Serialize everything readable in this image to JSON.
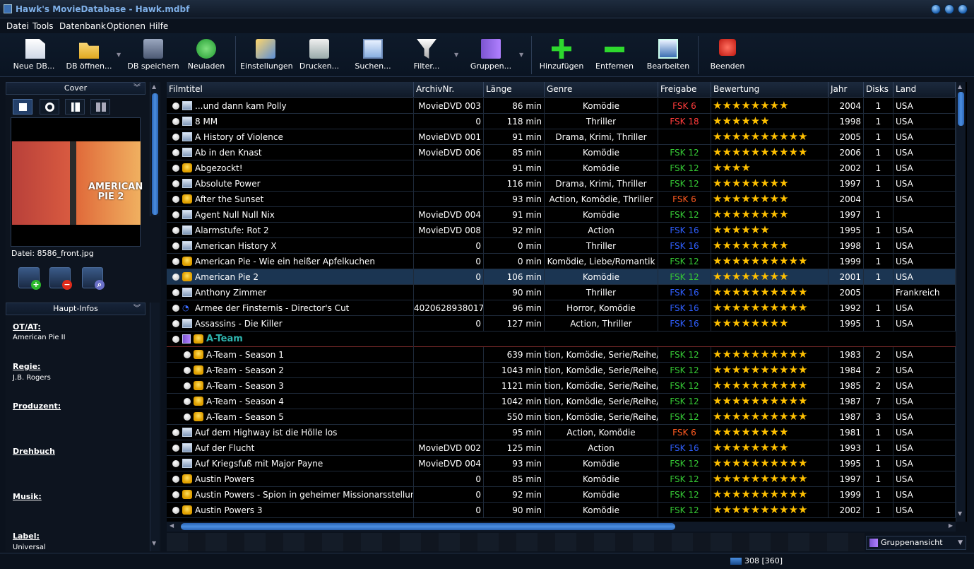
{
  "window": {
    "title": "Hawk's MovieDatabase - Hawk.mdbf"
  },
  "menu": [
    "Datei",
    "Tools",
    "Datenbank",
    "Optionen",
    "Hilfe"
  ],
  "toolbar": [
    {
      "label": "Neue DB...",
      "icon": "new-document-icon"
    },
    {
      "label": "DB öffnen...",
      "icon": "open-folder-icon"
    },
    {
      "label": "DB speichern",
      "icon": "save-icon"
    },
    {
      "label": "Neuladen",
      "icon": "reload-icon"
    },
    {
      "label": "Einstellungen",
      "icon": "settings-icon"
    },
    {
      "label": "Drucken...",
      "icon": "print-icon"
    },
    {
      "label": "Suchen...",
      "icon": "search-icon"
    },
    {
      "label": "Filter...",
      "icon": "filter-icon"
    },
    {
      "label": "Gruppen...",
      "icon": "groups-icon"
    },
    {
      "label": "Hinzufügen",
      "icon": "add-icon"
    },
    {
      "label": "Entfernen",
      "icon": "remove-icon"
    },
    {
      "label": "Bearbeiten",
      "icon": "edit-icon"
    },
    {
      "label": "Beenden",
      "icon": "power-icon"
    }
  ],
  "left": {
    "cover_header": "Cover",
    "cover_text": "AMERICAN PIE 2",
    "file_label": "Datei: 8586_front.jpg",
    "info_header": "Haupt-Infos",
    "info": [
      {
        "label": "OT/AT:",
        "value": "American Pie II"
      },
      {
        "label": "Regie:",
        "value": "J.B. Rogers"
      },
      {
        "label": "Produzent:",
        "value": ""
      },
      {
        "label": "Drehbuch",
        "value": ""
      },
      {
        "label": "Musik:",
        "value": ""
      },
      {
        "label": "Label:",
        "value": "Universal"
      }
    ]
  },
  "columns": [
    "Filmtitel",
    "ArchivNr.",
    "Länge",
    "Genre",
    "Freigabe",
    "Bewertung",
    "Jahr",
    "Disks",
    "Land"
  ],
  "rows": [
    {
      "type": "dvd",
      "title": "...und dann kam Polly",
      "archiv": "MovieDVD 003",
      "len": "86 min",
      "genre": "Komödie",
      "fsk": "FSK 6",
      "fskc": "red",
      "rating": 8,
      "year": "2004",
      "disks": "1",
      "land": "USA"
    },
    {
      "type": "dvd",
      "title": "8 MM",
      "archiv": "0",
      "len": "118 min",
      "genre": "Thriller",
      "fsk": "FSK 18",
      "fskc": "red",
      "rating": 6,
      "year": "1998",
      "disks": "1",
      "land": "USA"
    },
    {
      "type": "dvd",
      "title": "A History of Violence",
      "archiv": "MovieDVD 001",
      "len": "91 min",
      "genre": "Drama, Krimi, Thriller",
      "fsk": "",
      "fskc": "",
      "rating": 10,
      "year": "2005",
      "disks": "1",
      "land": "USA"
    },
    {
      "type": "dvd",
      "title": "Ab in den Knast",
      "archiv": "MovieDVD 006",
      "len": "85 min",
      "genre": "Komödie",
      "fsk": "FSK 12",
      "fskc": "green",
      "rating": 10,
      "year": "2006",
      "disks": "1",
      "land": "USA"
    },
    {
      "type": "vhs",
      "title": "Abgezockt!",
      "archiv": "",
      "len": "91 min",
      "genre": "Komödie",
      "fsk": "FSK 12",
      "fskc": "green",
      "rating": 4,
      "year": "2002",
      "disks": "1",
      "land": "USA"
    },
    {
      "type": "dvd",
      "title": "Absolute Power",
      "archiv": "",
      "len": "116 min",
      "genre": "Drama, Krimi, Thriller",
      "fsk": "FSK 12",
      "fskc": "green",
      "rating": 8,
      "year": "1997",
      "disks": "1",
      "land": "USA"
    },
    {
      "type": "vhs",
      "title": "After the Sunset",
      "archiv": "",
      "len": "93 min",
      "genre": "Action, Komödie, Thriller",
      "fsk": "FSK 6",
      "fskc": "orange",
      "rating": 8,
      "year": "2004",
      "disks": "",
      "land": "USA"
    },
    {
      "type": "dvd",
      "title": "Agent Null Null Nix",
      "archiv": "MovieDVD 004",
      "len": "91 min",
      "genre": "Komödie",
      "fsk": "FSK 12",
      "fskc": "green",
      "rating": 8,
      "year": "1997",
      "disks": "1",
      "land": ""
    },
    {
      "type": "dvd",
      "title": "Alarmstufe: Rot 2",
      "archiv": "MovieDVD 008",
      "len": "92 min",
      "genre": "Action",
      "fsk": "FSK 16",
      "fskc": "blue",
      "rating": 6,
      "year": "1995",
      "disks": "1",
      "land": "USA"
    },
    {
      "type": "dvd",
      "title": "American History X",
      "archiv": "0",
      "len": "0 min",
      "genre": "Thriller",
      "fsk": "FSK 16",
      "fskc": "blue",
      "rating": 8,
      "year": "1998",
      "disks": "1",
      "land": "USA"
    },
    {
      "type": "vhs",
      "title": "American Pie - Wie ein heißer Apfelkuchen",
      "archiv": "0",
      "len": "0 min",
      "genre": "Komödie, Liebe/Romantik",
      "fsk": "FSK 12",
      "fskc": "green",
      "rating": 10,
      "year": "1999",
      "disks": "1",
      "land": "USA"
    },
    {
      "type": "vhs",
      "title": "American Pie 2",
      "archiv": "0",
      "len": "106 min",
      "genre": "Komödie",
      "fsk": "FSK 12",
      "fskc": "green",
      "rating": 8,
      "year": "2001",
      "disks": "1",
      "land": "USA",
      "sel": true
    },
    {
      "type": "dvd",
      "title": "Anthony Zimmer",
      "archiv": "",
      "len": "90 min",
      "genre": "Thriller",
      "fsk": "FSK 16",
      "fskc": "blue",
      "rating": 10,
      "year": "2005",
      "disks": "",
      "land": "Frankreich"
    },
    {
      "type": "bd",
      "title": "Armee der Finsternis - Director's Cut",
      "archiv": "4020628938017",
      "len": "96 min",
      "genre": "Horror, Komödie",
      "fsk": "FSK 16",
      "fskc": "blue",
      "rating": 10,
      "year": "1992",
      "disks": "1",
      "land": "USA"
    },
    {
      "type": "dvd",
      "title": "Assassins - Die Killer",
      "archiv": "0",
      "len": "127 min",
      "genre": "Action, Thriller",
      "fsk": "FSK 16",
      "fskc": "blue",
      "rating": 8,
      "year": "1995",
      "disks": "1",
      "land": "USA"
    },
    {
      "type": "group",
      "title": "A-Team"
    },
    {
      "type": "vhs",
      "child": true,
      "title": "A-Team - Season 1",
      "archiv": "",
      "len": "639 min",
      "genre": "tion, Komödie, Serie/Reihe/C",
      "fsk": "FSK 12",
      "fskc": "green",
      "rating": 10,
      "year": "1983",
      "disks": "2",
      "land": "USA"
    },
    {
      "type": "vhs",
      "child": true,
      "title": "A-Team - Season 2",
      "archiv": "",
      "len": "1043 min",
      "genre": "tion, Komödie, Serie/Reihe/C",
      "fsk": "FSK 12",
      "fskc": "green",
      "rating": 10,
      "year": "1984",
      "disks": "2",
      "land": "USA"
    },
    {
      "type": "vhs",
      "child": true,
      "title": "A-Team - Season 3",
      "archiv": "",
      "len": "1121 min",
      "genre": "tion, Komödie, Serie/Reihe/C",
      "fsk": "FSK 12",
      "fskc": "green",
      "rating": 10,
      "year": "1985",
      "disks": "2",
      "land": "USA"
    },
    {
      "type": "vhs",
      "child": true,
      "title": "A-Team - Season 4",
      "archiv": "",
      "len": "1042 min",
      "genre": "tion, Komödie, Serie/Reihe/C",
      "fsk": "FSK 12",
      "fskc": "green",
      "rating": 10,
      "year": "1987",
      "disks": "7",
      "land": "USA"
    },
    {
      "type": "vhs",
      "child": true,
      "title": "A-Team - Season 5",
      "archiv": "",
      "len": "550 min",
      "genre": "tion, Komödie, Serie/Reihe/C",
      "fsk": "FSK 12",
      "fskc": "green",
      "rating": 10,
      "year": "1987",
      "disks": "3",
      "land": "USA"
    },
    {
      "type": "dvd",
      "title": "Auf dem Highway ist die Hölle los",
      "archiv": "",
      "len": "95 min",
      "genre": "Action, Komödie",
      "fsk": "FSK 6",
      "fskc": "orange",
      "rating": 8,
      "year": "1981",
      "disks": "1",
      "land": "USA"
    },
    {
      "type": "dvd",
      "title": "Auf der Flucht",
      "archiv": "MovieDVD 002",
      "len": "125 min",
      "genre": "Action",
      "fsk": "FSK 16",
      "fskc": "blue",
      "rating": 8,
      "year": "1993",
      "disks": "1",
      "land": "USA"
    },
    {
      "type": "dvd",
      "title": "Auf Kriegsfuß mit Major Payne",
      "archiv": "MovieDVD 004",
      "len": "93 min",
      "genre": "Komödie",
      "fsk": "FSK 12",
      "fskc": "green",
      "rating": 10,
      "year": "1995",
      "disks": "1",
      "land": "USA"
    },
    {
      "type": "vhs",
      "title": "Austin Powers",
      "archiv": "0",
      "len": "85 min",
      "genre": "Komödie",
      "fsk": "FSK 12",
      "fskc": "green",
      "rating": 10,
      "year": "1997",
      "disks": "1",
      "land": "USA"
    },
    {
      "type": "vhs",
      "title": "Austin Powers - Spion in geheimer Missionarsstellung",
      "archiv": "0",
      "len": "92 min",
      "genre": "Komödie",
      "fsk": "FSK 12",
      "fskc": "green",
      "rating": 10,
      "year": "1999",
      "disks": "1",
      "land": "USA"
    },
    {
      "type": "vhs",
      "title": "Austin Powers 3",
      "archiv": "0",
      "len": "90 min",
      "genre": "Komödie",
      "fsk": "FSK 12",
      "fskc": "green",
      "rating": 10,
      "year": "2002",
      "disks": "1",
      "land": "USA"
    }
  ],
  "group_selector": "Gruppenansicht",
  "status": {
    "count": "308 [360]"
  }
}
